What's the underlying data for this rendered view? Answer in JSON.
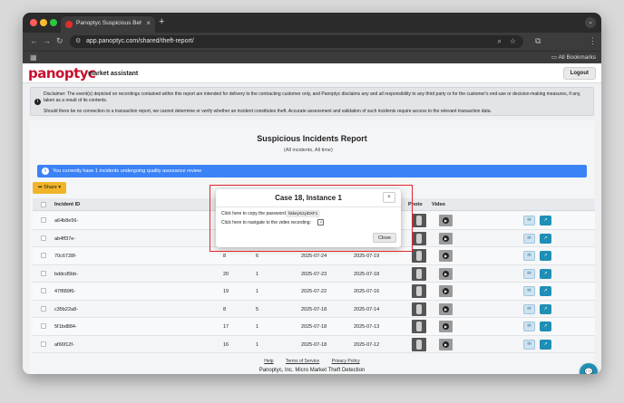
{
  "browser": {
    "tab_title": "Panoptyc Suspicious Behavi",
    "tab_close": "×",
    "new_tab": "+",
    "url": "app.panoptyc.com/shared/theft-report/",
    "all_bookmarks": "All Bookmarks"
  },
  "header": {
    "logo": "panoptyc",
    "logo_sub": "market assistant",
    "logout": "Logout"
  },
  "disclaimer": {
    "line1": "Disclaimer: The event(s) depicted on recordings contained within this report are intended for delivery to the contracting customer only, and Panoptyc disclaims any and all responsibility to any third party or for the customer's end-use or decision-making measures, if any, taken as a result of its contents.",
    "line2": "Should there be no connection to a transaction report, we cannot determine or verify whether an incident constitutes theft. Accurate assessment and validation of such incidents require access to the relevant transaction data."
  },
  "report": {
    "title": "Suspicious Incidents Report",
    "subtitle": "(All incidents, All time)",
    "qa_banner": "You currently have 1 incidents undergoing quality assurance review",
    "share": "Share"
  },
  "table": {
    "headers": {
      "incident_id": "Incident ID",
      "photo": "Photo",
      "video": "Video"
    },
    "rows": [
      {
        "id": "a64b8e56-",
        "c1": "",
        "c2": "",
        "d1": "",
        "d2": ""
      },
      {
        "id": "ab4ff37e-",
        "c1": "",
        "c2": "",
        "d1": "",
        "d2": ""
      },
      {
        "id": "70c6728f-",
        "c1": "8",
        "c2": "6",
        "d1": "2025-07-24",
        "d2": "2025-07-19"
      },
      {
        "id": "bddcd5bb-",
        "c1": "20",
        "c2": "1",
        "d1": "2025-07-23",
        "d2": "2025-07-18"
      },
      {
        "id": "47f889f6-",
        "c1": "19",
        "c2": "1",
        "d1": "2025-07-22",
        "d2": "2025-07-16"
      },
      {
        "id": "c35b22a8-",
        "c1": "8",
        "c2": "5",
        "d1": "2025-07-18",
        "d2": "2025-07-14"
      },
      {
        "id": "5f1bd884-",
        "c1": "17",
        "c2": "1",
        "d1": "2025-07-18",
        "d2": "2025-07-13"
      },
      {
        "id": "af66f12f-",
        "c1": "16",
        "c2": "1",
        "d1": "2025-07-18",
        "d2": "2025-07-12"
      }
    ]
  },
  "footer": {
    "help": "Help",
    "terms": "Terms of Service",
    "privacy": "Privacy Policy",
    "copy": "Panoptyc, Inc. Micro Market Theft Detection"
  },
  "modal": {
    "title": "Case 18, Instance 1",
    "close_x": "×",
    "copy_label": "Click here to copy the password:",
    "password": "hkkeyGzyiDXF1",
    "nav_label": "Click here to navigate to the video recording:",
    "close_button": "Close"
  }
}
